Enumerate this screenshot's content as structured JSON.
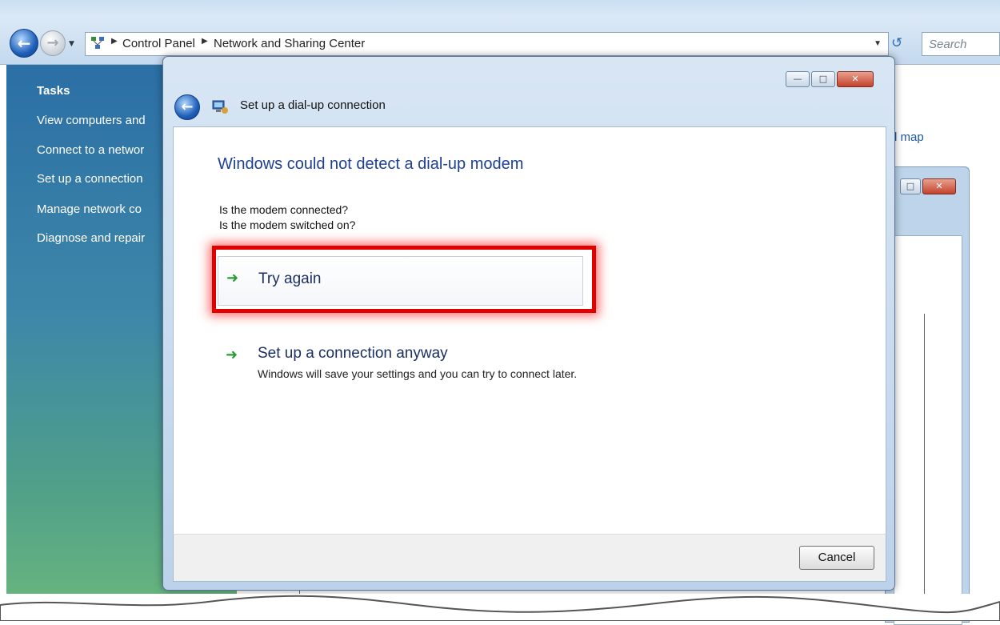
{
  "explorer": {
    "breadcrumb": [
      "Control Panel",
      "Network and Sharing Center"
    ],
    "search_placeholder": "Search"
  },
  "sidebar": {
    "heading": "Tasks",
    "items": [
      {
        "label": "View computers and"
      },
      {
        "label": "Connect to a networ"
      },
      {
        "label": "Set up a connection"
      },
      {
        "label": "Manage network co"
      },
      {
        "label": "Diagnose and repair"
      }
    ]
  },
  "background": {
    "map_link": "l map"
  },
  "dialog": {
    "title": "Set up a dial-up connection",
    "heading": "Windows could not detect a dial-up modem",
    "questions": [
      "Is the modem connected?",
      "Is the modem switched on?"
    ],
    "options": [
      {
        "label": "Try again",
        "description": ""
      },
      {
        "label": "Set up a connection anyway",
        "description": "Windows will save your settings and you can try to connect later."
      }
    ],
    "cancel_label": "Cancel"
  },
  "colors": {
    "highlight": "#e00000",
    "heading": "#1e3f96",
    "arrow": "#2b9a34"
  },
  "icons": [
    "back-arrow-icon",
    "forward-arrow-icon",
    "network-icon",
    "refresh-icon",
    "minimize-icon",
    "maximize-icon",
    "close-icon",
    "green-arrow-icon"
  ]
}
